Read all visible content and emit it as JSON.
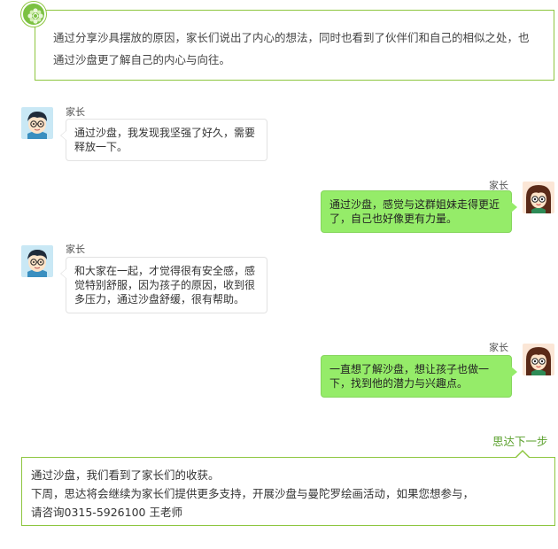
{
  "summary": {
    "text": "通过分享沙具摆放的原因，家长们说出了内心的想法，同时也看到了伙伴们和自己的相似之处，也通过沙盘更了解自己的内心与向往。"
  },
  "messages": [
    {
      "side": "left",
      "speaker": "家长",
      "text": "通过沙盘，我发现我坚强了好久，需要释放一下。"
    },
    {
      "side": "right",
      "speaker": "家长",
      "text": "通过沙盘，感觉与这群姐妹走得更近了，自己也好像更有力量。"
    },
    {
      "side": "left",
      "speaker": "家长",
      "text": "和大家在一起，才觉得很有安全感，感觉特别舒服，因为孩子的原因，收到很多压力，通过沙盘舒缓，很有帮助。"
    },
    {
      "side": "right",
      "speaker": "家长",
      "text": "一直想了解沙盘，想让孩子也做一下，找到他的潜力与兴趣点。"
    }
  ],
  "next_step": {
    "label": "思达下一步",
    "lines": [
      "通过沙盘，我们看到了家长们的收获。",
      "下周，思达将会继续为家长们提供更多支持，开展沙盘与曼陀罗绘画活动，如果您想参与，",
      "请咨询0315-5926100  王老师"
    ]
  },
  "colors": {
    "accent_green": "#8dc63f",
    "bubble_green": "#95ec69",
    "link_green": "#5aa02c"
  },
  "icons": {
    "badge": "flower-badge-icon",
    "avatar_male": "boy-avatar-icon",
    "avatar_female": "girl-avatar-icon"
  }
}
